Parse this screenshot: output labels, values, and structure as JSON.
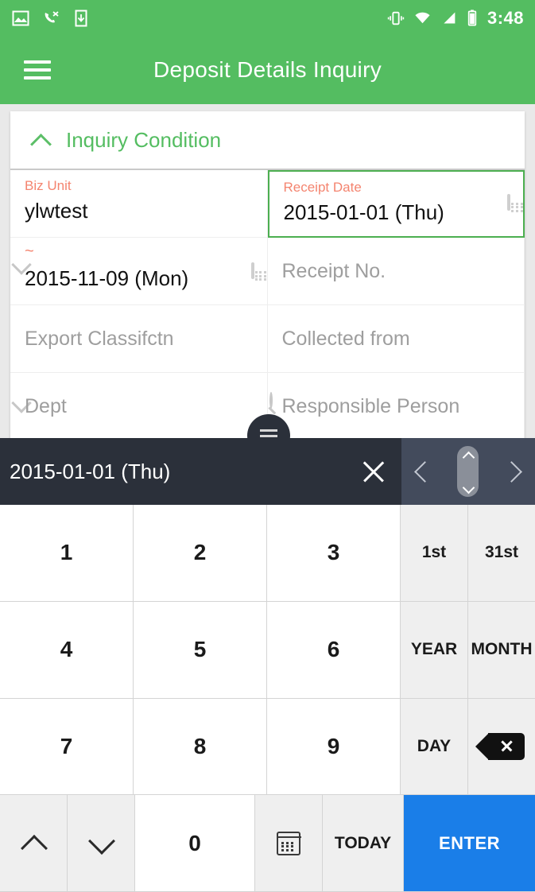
{
  "status_bar": {
    "time": "3:48",
    "left_icons": [
      "image-icon",
      "missed-call-icon",
      "phone-download-icon"
    ],
    "right_icons": [
      "vibrate-icon",
      "wifi-icon",
      "cellular-signal-icon",
      "battery-icon"
    ]
  },
  "app_bar": {
    "title": "Deposit Details Inquiry",
    "menu_icon": "hamburger-menu-icon"
  },
  "card": {
    "section_title": "Inquiry Condition",
    "collapse_icon": "chevron-up-icon",
    "fields": [
      {
        "label": "Biz Unit",
        "value": "ylwtest",
        "placeholder": "",
        "icon": "chevron-down-icon",
        "focused": false
      },
      {
        "label": "Receipt Date",
        "value": "2015-01-01 (Thu)",
        "placeholder": "",
        "icon": "calendar-icon",
        "focused": true
      },
      {
        "label": "~",
        "value": "2015-11-09 (Mon)",
        "placeholder": "",
        "icon": "calendar-icon",
        "focused": false
      },
      {
        "label": "",
        "value": "",
        "placeholder": "Receipt No.",
        "icon": "",
        "focused": false
      },
      {
        "label": "",
        "value": "",
        "placeholder": "Export Classifctn",
        "icon": "chevron-down-icon",
        "focused": false
      },
      {
        "label": "",
        "value": "",
        "placeholder": "Collected from",
        "icon": "search-icon",
        "focused": false
      },
      {
        "label": "",
        "value": "",
        "placeholder": "Dept",
        "icon": "search-icon",
        "focused": false
      },
      {
        "label": "",
        "value": "",
        "placeholder": "Responsible Person",
        "icon": "search-icon",
        "focused": false
      }
    ]
  },
  "fab": {
    "icon": "list-menu-icon"
  },
  "keyboard": {
    "header": {
      "date_value": "2015-01-01 (Thu)",
      "close_icon": "close-icon",
      "prev_icon": "chevron-left-icon",
      "next_icon": "chevron-right-icon",
      "drag_handle_icon": "drag-handle-icon"
    },
    "rows": [
      {
        "keys": [
          {
            "label": "1",
            "type": "num"
          },
          {
            "label": "2",
            "type": "num"
          },
          {
            "label": "3",
            "type": "num"
          },
          {
            "label": "1st",
            "type": "side"
          },
          {
            "label": "31st",
            "type": "side"
          }
        ]
      },
      {
        "keys": [
          {
            "label": "4",
            "type": "num"
          },
          {
            "label": "5",
            "type": "num"
          },
          {
            "label": "6",
            "type": "num"
          },
          {
            "label": "YEAR",
            "type": "side"
          },
          {
            "label": "MONTH",
            "type": "side"
          }
        ]
      },
      {
        "keys": [
          {
            "label": "7",
            "type": "num"
          },
          {
            "label": "8",
            "type": "num"
          },
          {
            "label": "9",
            "type": "num"
          },
          {
            "label": "DAY",
            "type": "side"
          },
          {
            "label": "",
            "type": "backspace",
            "icon": "backspace-icon"
          }
        ]
      },
      {
        "keys": [
          {
            "label": "",
            "type": "fn",
            "icon": "chevron-up-icon"
          },
          {
            "label": "",
            "type": "fn",
            "icon": "chevron-down-icon"
          },
          {
            "label": "0",
            "type": "zero"
          },
          {
            "label": "",
            "type": "calkey",
            "icon": "calendar-icon"
          },
          {
            "label": "TODAY",
            "type": "today"
          },
          {
            "label": "ENTER",
            "type": "enter"
          }
        ]
      }
    ]
  },
  "colors": {
    "brand_green": "#54bd61",
    "label_salmon": "#f4846f",
    "focus_green": "#4caf50",
    "keyboard_dark": "#2b303a",
    "keyboard_nav": "#434b5c",
    "enter_blue": "#1a7ee8"
  }
}
